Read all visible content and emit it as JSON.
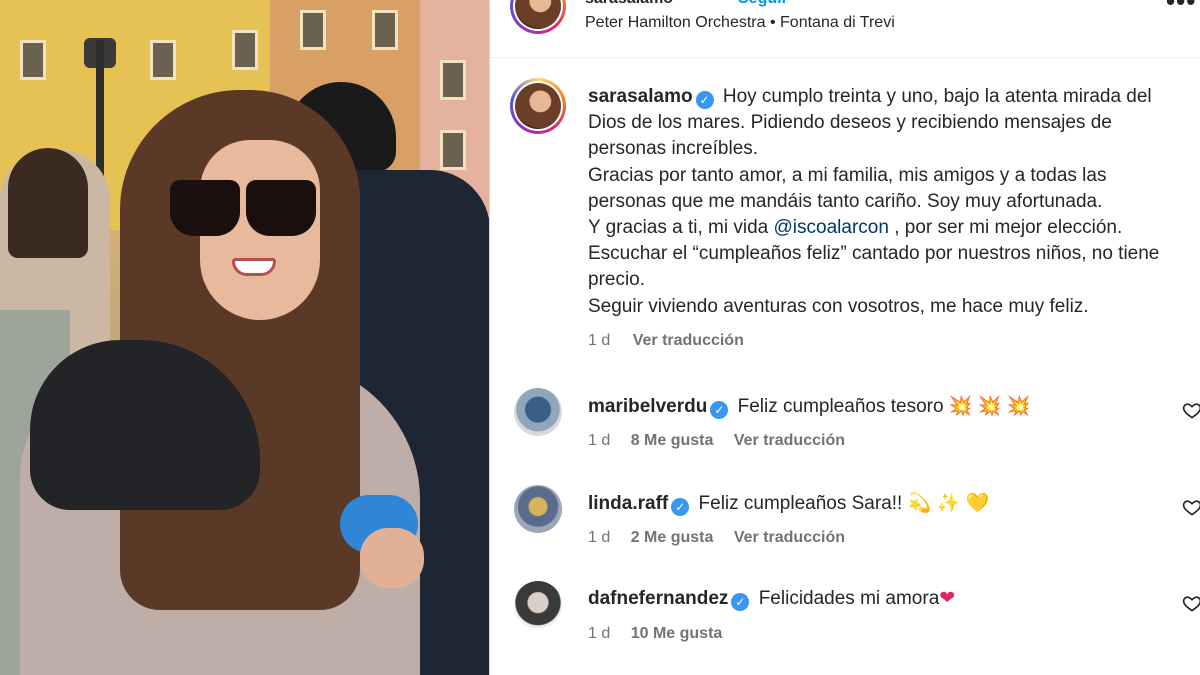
{
  "post": {
    "username": "sarasalamo",
    "follow_label": "Seguir",
    "separator": "•",
    "audio": "Peter Hamilton Orchestra",
    "location": "Fontana di Trevi",
    "sub_separator": "•",
    "more_icon": "more-horizontal-icon",
    "more_glyph": "•••"
  },
  "caption": {
    "username": "sarasalamo",
    "text_part1": "Hoy cumplo treinta y uno, bajo la atenta mirada del Dios de los mares. Pidiendo deseos y recibiendo mensajes de personas increíbles.",
    "text_part2": "Gracias por tanto amor, a mi familia, mis amigos y a todas las personas que me mandáis tanto cariño. Soy muy afortunada.",
    "text_part3_before": "Y gracias a ti, mi vida ",
    "mention": "@iscoalarcon",
    "text_part3_after": " , por ser mi mejor elección.",
    "text_part4": "Escuchar el “cumpleaños feliz” cantado por nuestros niños, no tiene precio.",
    "text_part5": "Seguir viviendo aventuras con vosotros, me hace muy feliz.",
    "time": "1 d",
    "translate": "Ver traducción"
  },
  "comments": [
    {
      "username": "maribelverdu",
      "text": "Feliz cumpleaños tesoro",
      "emoji": "💥 💥 💥",
      "time": "1 d",
      "likes": "8 Me gusta",
      "translate": "Ver traducción"
    },
    {
      "username": "linda.raff",
      "text": "Feliz cumpleaños Sara!!",
      "emoji": "💫 ✨ 💛",
      "time": "1 d",
      "likes": "2 Me gusta",
      "translate": "Ver traducción"
    },
    {
      "username": "dafnefernandez",
      "text": "Felicidades mi amora",
      "emoji": "❤",
      "time": "1 d",
      "likes": "10 Me gusta",
      "translate": ""
    }
  ],
  "colors": {
    "accent": "#0095f6",
    "verified": "#3897f0",
    "muted": "#737373",
    "mention": "#00376b"
  }
}
